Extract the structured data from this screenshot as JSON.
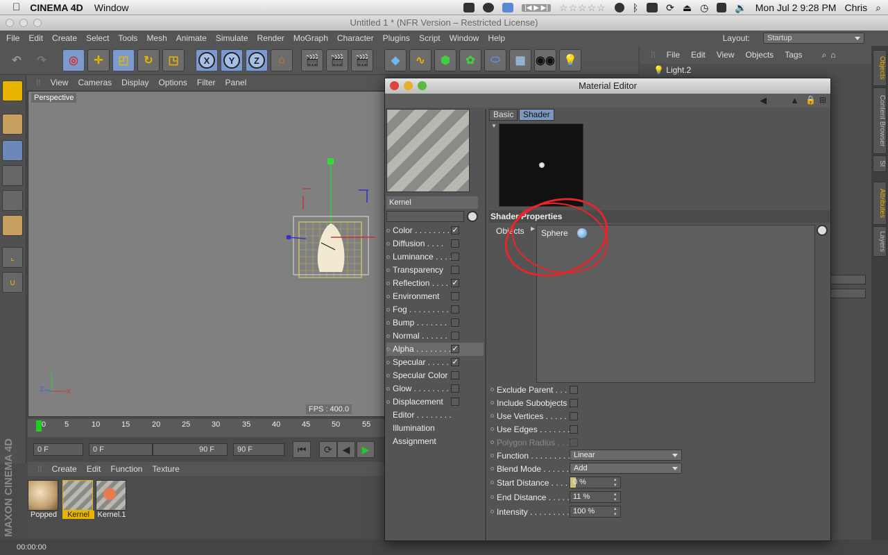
{
  "mac": {
    "app_name": "CINEMA 4D",
    "menus": [
      "Window"
    ],
    "clock": "Mon Jul 2  9:28 PM",
    "user": "Chris",
    "stars": "☆☆☆☆☆"
  },
  "window": {
    "title": "Untitled 1 * (NFR Version – Restricted License)"
  },
  "c4d_menu": [
    "File",
    "Edit",
    "Create",
    "Select",
    "Tools",
    "Mesh",
    "Animate",
    "Simulate",
    "Render",
    "MoGraph",
    "Character",
    "Plugins",
    "Script",
    "Window",
    "Help"
  ],
  "layout": {
    "label": "Layout:",
    "value": "Startup"
  },
  "viewport": {
    "menu": [
      "View",
      "Cameras",
      "Display",
      "Options",
      "Filter",
      "Panel"
    ],
    "label": "Perspective",
    "fps": "FPS : 400.0"
  },
  "timeline": {
    "ticks": [
      "0",
      "5",
      "10",
      "15",
      "20",
      "25",
      "30",
      "35",
      "40",
      "45",
      "50",
      "55"
    ],
    "current": "0 F",
    "range_start": "0 F",
    "range_end": "90 F",
    "end": "90 F"
  },
  "materials": {
    "menu": [
      "Create",
      "Edit",
      "Function",
      "Texture"
    ],
    "items": [
      "Popped",
      "Kernel",
      "Kernel.1"
    ]
  },
  "status": {
    "time": "00:00:00"
  },
  "maxon": "MAXON CINEMA 4D",
  "objects": {
    "menu": [
      "File",
      "Edit",
      "View",
      "Objects",
      "Tags"
    ],
    "row": "Light.2"
  },
  "right_tabs": [
    "Objects",
    "Content Browser",
    "St",
    "Attributes",
    "Layers"
  ],
  "material_editor": {
    "title": "Material Editor",
    "name": "Kernel",
    "channels": [
      {
        "label": "Color . . . . . . . .",
        "checked": "✓"
      },
      {
        "label": "Diffusion  . . . .",
        "checked": ""
      },
      {
        "label": "Luminance . . . .",
        "checked": ""
      },
      {
        "label": "Transparency",
        "checked": ""
      },
      {
        "label": "Reflection . . . .",
        "checked": "✓"
      },
      {
        "label": "Environment",
        "checked": ""
      },
      {
        "label": "Fog . . . . . . . . .",
        "checked": ""
      },
      {
        "label": "Bump  . . . . . . .",
        "checked": ""
      },
      {
        "label": "Normal . . . . . .",
        "checked": ""
      },
      {
        "label": "Alpha . . . . . . . .",
        "checked": "✓"
      },
      {
        "label": "Specular . . . . .",
        "checked": "✓"
      },
      {
        "label": "Specular Color",
        "checked": ""
      },
      {
        "label": "Glow . . . . . . . .",
        "checked": ""
      },
      {
        "label": "Displacement",
        "checked": ""
      }
    ],
    "extras": [
      "Editor . . . . . . . .",
      "Illumination",
      "Assignment"
    ],
    "tabs": [
      "Basic",
      "Shader"
    ],
    "section": "Shader Properties",
    "objects_label": "Objects",
    "objects_item": "Sphere",
    "props": [
      {
        "label": "Exclude Parent  . . .",
        "kind": "check"
      },
      {
        "label": "Include Subobjects",
        "kind": "check"
      },
      {
        "label": "Use Vertices . . . . . .",
        "kind": "check"
      },
      {
        "label": "Use Edges  . . . . . . .",
        "kind": "check"
      },
      {
        "label": "Polygon Radius . . .",
        "kind": "check"
      },
      {
        "label": "Function . . . . . . . . .",
        "kind": "dropdown",
        "value": "Linear"
      },
      {
        "label": "Blend Mode . . . . . .",
        "kind": "dropdown",
        "value": "Add"
      },
      {
        "label": "Start Distance . . . . .",
        "kind": "number",
        "value": "0 %"
      },
      {
        "label": "End Distance . . . . .",
        "kind": "number",
        "value": "11 %"
      },
      {
        "label": "Intensity . . . . . . . . .",
        "kind": "number",
        "value": "100 %"
      }
    ]
  }
}
